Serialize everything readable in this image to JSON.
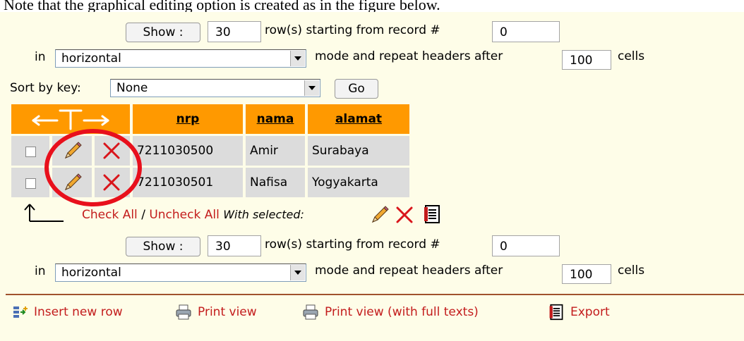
{
  "context_text": "Note that the graphical editing option is created as in the figure below.",
  "nav_top": {
    "show_button": "Show :",
    "rows_value": "30",
    "starting_label": "row(s) starting from record #",
    "start_value": "0",
    "in_label": "in",
    "mode_value": "horizontal",
    "repeat_label": "mode and repeat headers after",
    "repeat_value": "100",
    "cells_label": "cells"
  },
  "sort": {
    "label": "Sort by key:",
    "value": "None",
    "go_button": "Go"
  },
  "table": {
    "columns": [
      "nrp",
      "nama",
      "alamat"
    ],
    "rows": [
      {
        "nrp": "7211030500",
        "nama": "Amir",
        "alamat": "Surabaya"
      },
      {
        "nrp": "7211030501",
        "nama": "Nafisa",
        "alamat": "Yogyakarta"
      }
    ]
  },
  "bulk": {
    "check_all": "Check All",
    "separator": "/",
    "uncheck_all": "Uncheck All",
    "with_selected": "With selected:"
  },
  "nav_bottom": {
    "show_button": "Show :",
    "rows_value": "30",
    "starting_label": "row(s) starting from record #",
    "start_value": "0",
    "in_label": "in",
    "mode_value": "horizontal",
    "repeat_label": "mode and repeat headers after",
    "repeat_value": "100",
    "cells_label": "cells"
  },
  "footer": {
    "insert": "Insert new row",
    "print": "Print view",
    "print_full": "Print view (with full texts)",
    "export": "Export"
  },
  "colors": {
    "header_bg": "#ff9900",
    "row_bg": "#dcdcdc",
    "link": "#c31c1c",
    "panel_bg": "#fefde8",
    "annotation": "#e8101c",
    "divider": "#a0522d"
  },
  "icons": [
    "pencil-icon",
    "delete-x-icon",
    "export-icon",
    "insert-row-icon",
    "printer-icon",
    "arrow-icon"
  ]
}
